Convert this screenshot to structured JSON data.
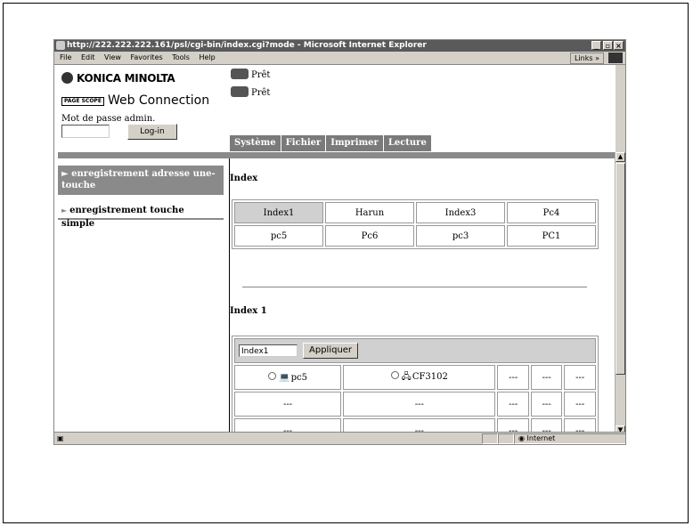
{
  "browser": {
    "title": "http://222.222.222.161/psl/cgi-bin/index.cgi?mode - Microsoft Internet Explorer",
    "menu": [
      "File",
      "Edit",
      "View",
      "Favorites",
      "Tools",
      "Help"
    ],
    "links_label": "Links »",
    "status_zone": "Internet"
  },
  "header": {
    "brand": "KONICA MINOLTA",
    "pagescope_badge": "PAGE SCOPE",
    "product": "Web Connection",
    "password_label": "Mot de passe admin.",
    "password_value": "",
    "login_label": "Log-in",
    "status_printer": "Prêt",
    "status_scanner": "Prêt"
  },
  "tabs": [
    "Système",
    "Fichier",
    "Imprimer",
    "Lecture"
  ],
  "sidebar": {
    "items": [
      {
        "label": "► enregistrement adresse une-touche"
      },
      {
        "label": "enregistrement touche simple"
      }
    ]
  },
  "main": {
    "index_heading": "Index",
    "index_rows": [
      [
        "Index1",
        "Harun",
        "Index3",
        "Pc4"
      ],
      [
        "pc5",
        "Pc6",
        "pc3",
        "PC1"
      ]
    ],
    "section_heading": "Index 1",
    "name_value": "Index1",
    "apply_label": "Appliquer",
    "entries": [
      [
        "pc5",
        "CF3102",
        "---",
        "---",
        "---"
      ],
      [
        "---",
        "---",
        "---",
        "---",
        "---"
      ],
      [
        "---",
        "---",
        "---",
        "---",
        "---"
      ]
    ]
  }
}
